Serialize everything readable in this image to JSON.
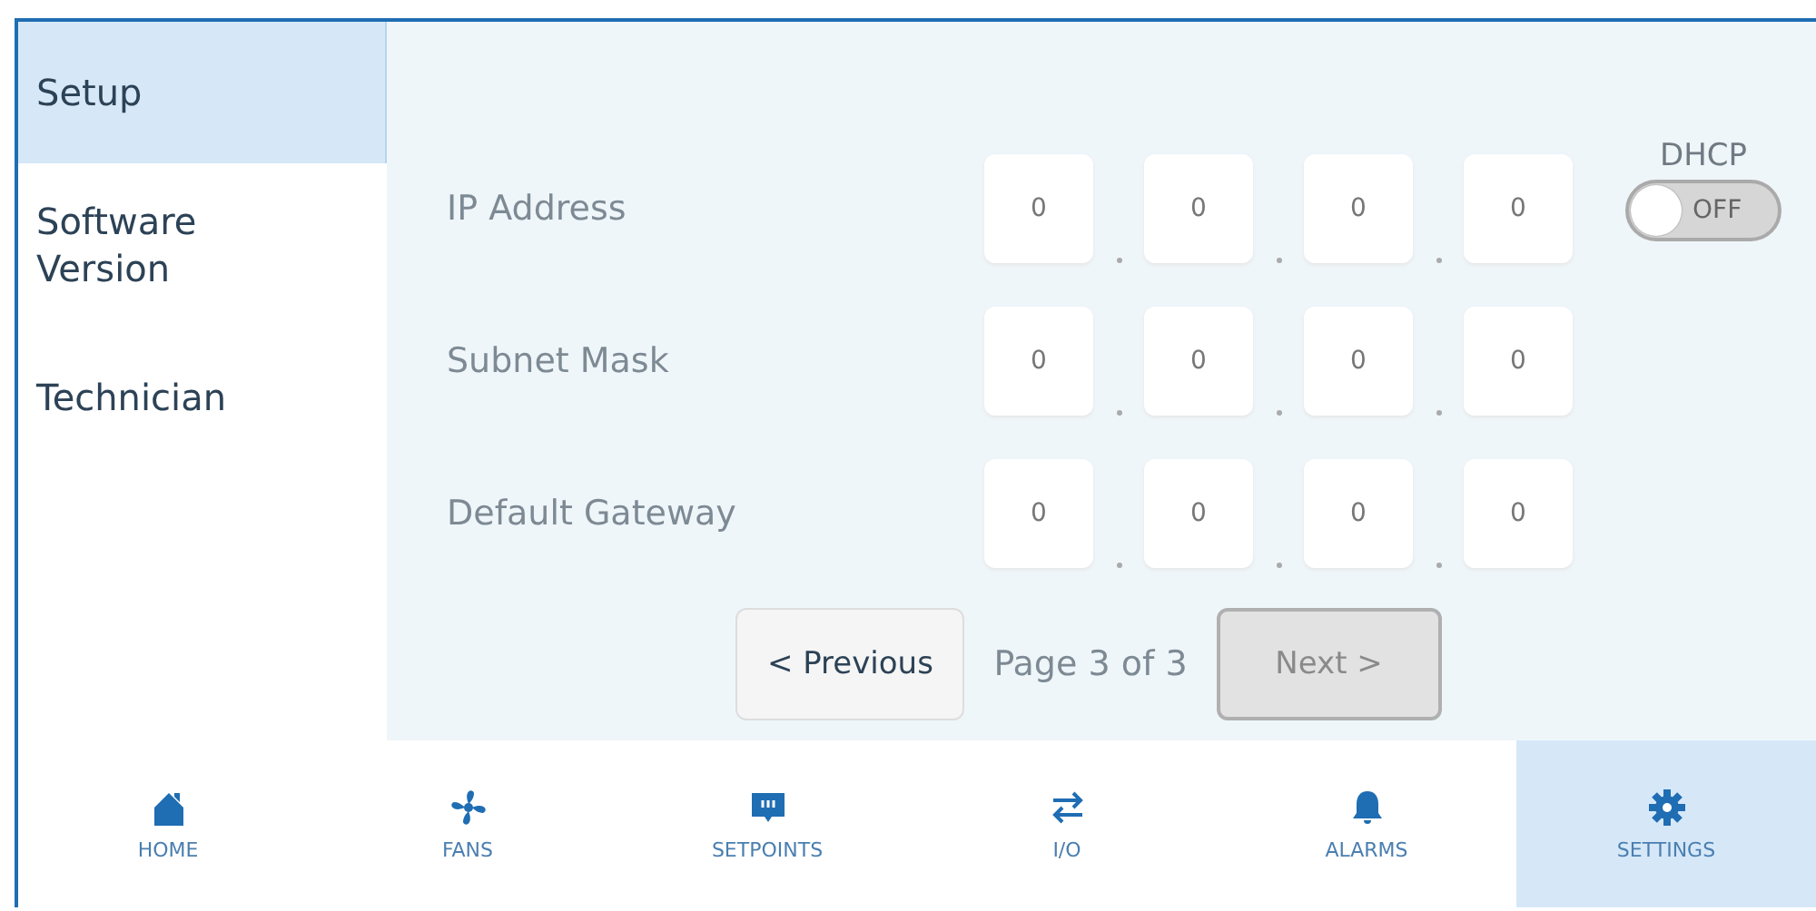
{
  "sidebar": {
    "items": [
      {
        "label": "Setup",
        "selected": true
      },
      {
        "label": "Software Version",
        "selected": false
      },
      {
        "label": "Technician",
        "selected": false
      }
    ]
  },
  "network": {
    "rows": [
      {
        "label": "IP Address",
        "octets": [
          "0",
          "0",
          "0",
          "0"
        ]
      },
      {
        "label": "Subnet Mask",
        "octets": [
          "0",
          "0",
          "0",
          "0"
        ]
      },
      {
        "label": "Default Gateway",
        "octets": [
          "0",
          "0",
          "0",
          "0"
        ]
      }
    ],
    "dhcp": {
      "label": "DHCP",
      "on": false,
      "state_text": "OFF"
    }
  },
  "pager": {
    "previous": {
      "label": "< Previous",
      "disabled": false
    },
    "page_text": "Page 3 of 3",
    "next": {
      "label": "Next >",
      "disabled": true
    }
  },
  "nav": [
    {
      "kind": "home",
      "label": "HOME",
      "selected": false
    },
    {
      "kind": "fan",
      "label": "FANS",
      "selected": false
    },
    {
      "kind": "setpoints",
      "label": "SETPOINTS",
      "selected": false
    },
    {
      "kind": "io",
      "label": "I/O",
      "selected": false
    },
    {
      "kind": "alarms",
      "label": "ALARMS",
      "selected": false
    },
    {
      "kind": "settings",
      "label": "SETTINGS",
      "selected": true
    }
  ]
}
